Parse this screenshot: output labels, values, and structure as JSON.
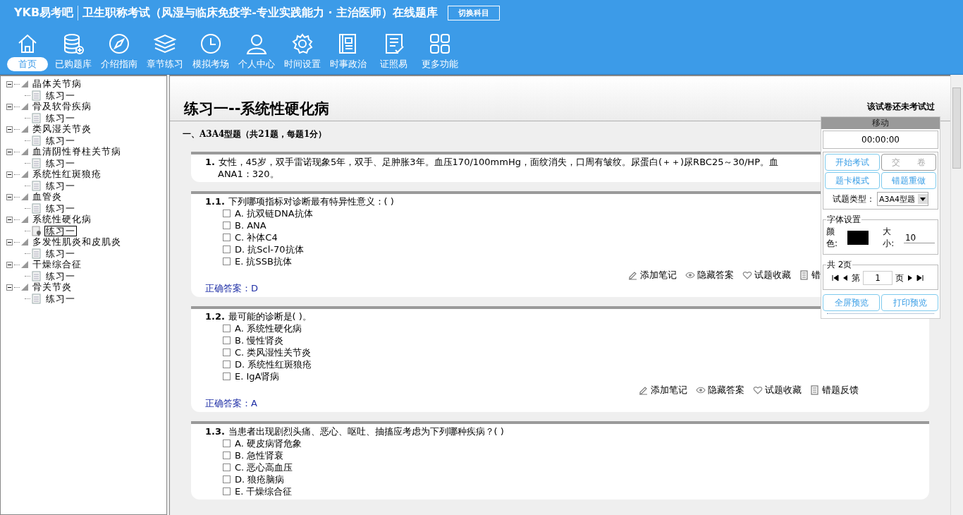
{
  "app": {
    "logo": "YKB易考吧",
    "title": "卫生职称考试（风湿与临床免疫学-专业实践能力 · 主治医师）在线题库",
    "switch_button": "切换科目"
  },
  "toolbar": [
    {
      "label": "首页",
      "selected": true
    },
    {
      "label": "已购题库",
      "selected": false
    },
    {
      "label": "介绍指南",
      "selected": false
    },
    {
      "label": "章节练习",
      "selected": false
    },
    {
      "label": "模拟考场",
      "selected": false
    },
    {
      "label": "个人中心",
      "selected": false
    },
    {
      "label": "时间设置",
      "selected": false
    },
    {
      "label": "时事政治",
      "selected": false
    },
    {
      "label": "证照易",
      "selected": false
    },
    {
      "label": "更多功能",
      "selected": false
    }
  ],
  "tree": [
    {
      "label": "晶体关节病",
      "expanded": true,
      "children": [
        {
          "label": "练习一",
          "selected": false
        }
      ]
    },
    {
      "label": "骨及软骨疾病",
      "expanded": true,
      "children": [
        {
          "label": "练习一",
          "selected": false
        }
      ]
    },
    {
      "label": "类风湿关节炎",
      "expanded": true,
      "children": [
        {
          "label": "练习一",
          "selected": false
        }
      ]
    },
    {
      "label": "血清阴性脊柱关节病",
      "expanded": true,
      "children": [
        {
          "label": "练习一",
          "selected": false
        }
      ]
    },
    {
      "label": "系统性红斑狼疮",
      "expanded": true,
      "children": [
        {
          "label": "练习一",
          "selected": false
        }
      ]
    },
    {
      "label": "血管炎",
      "expanded": true,
      "children": [
        {
          "label": "练习一",
          "selected": false
        }
      ]
    },
    {
      "label": "系统性硬化病",
      "expanded": true,
      "children": [
        {
          "label": "练习一",
          "selected": true
        }
      ]
    },
    {
      "label": "多发性肌炎和皮肌炎",
      "expanded": true,
      "children": [
        {
          "label": "练习一",
          "selected": false
        }
      ]
    },
    {
      "label": "干燥综合征",
      "expanded": true,
      "children": [
        {
          "label": "练习一",
          "selected": false
        }
      ]
    },
    {
      "label": "骨关节炎",
      "expanded": true,
      "children": [
        {
          "label": "练习一",
          "selected": false
        }
      ]
    }
  ],
  "paper": {
    "title": "练习一--系统性硬化病",
    "status": "该试卷还未考试过",
    "section": "一、A3A4型题（共21题，每题1分）"
  },
  "questions": [
    {
      "kind": "stem",
      "number": "1.",
      "text": "女性，45岁，双手雷诺现象5年，双手、足肿胀3年。血压170/100mmHg，面纹消失，口周有皱纹。尿蛋白(＋＋)尿RBC25～30/HP。血",
      "text2": "ANA1：320。"
    },
    {
      "kind": "choice",
      "number": "1.1.",
      "text": "下列哪项指标对诊断最有特异性意义：( )",
      "options": [
        {
          "letter": "A.",
          "text": "抗双链DNA抗体",
          "checked": false
        },
        {
          "letter": "B.",
          "text": "ANA",
          "checked": false
        },
        {
          "letter": "C.",
          "text": "补体C4",
          "checked": false
        },
        {
          "letter": "D.",
          "text": "抗Scl-70抗体",
          "checked": false
        },
        {
          "letter": "E.",
          "text": "抗SSB抗体",
          "checked": false
        }
      ],
      "actions": [
        {
          "label": "添加笔记"
        },
        {
          "label": "隐藏答案"
        },
        {
          "label": "试题收藏"
        },
        {
          "label": "错"
        }
      ],
      "answer_label": "正确答案：",
      "answer": "D"
    },
    {
      "kind": "choice",
      "number": "1.2.",
      "text": "最可能的诊断是( )。",
      "options": [
        {
          "letter": "A.",
          "text": "系统性硬化病",
          "checked": false
        },
        {
          "letter": "B.",
          "text": "慢性肾炎",
          "checked": false
        },
        {
          "letter": "C.",
          "text": "类风湿性关节炎",
          "checked": false
        },
        {
          "letter": "D.",
          "text": "系统性红斑狼疮",
          "checked": false
        },
        {
          "letter": "E.",
          "text": "IgA肾病",
          "checked": false
        }
      ],
      "actions": [
        {
          "label": "添加笔记"
        },
        {
          "label": "隐藏答案"
        },
        {
          "label": "试题收藏"
        },
        {
          "label": "错题反馈"
        }
      ],
      "answer_label": "正确答案：",
      "answer": "A"
    },
    {
      "kind": "choice",
      "number": "1.3.",
      "text": "当患者出现剧烈头痛、恶心、呕吐、抽搐应考虑为下列哪种疾病？( )",
      "options": [
        {
          "letter": "A.",
          "text": "硬皮病肾危象",
          "checked": false
        },
        {
          "letter": "B.",
          "text": "急性肾衰",
          "checked": false
        },
        {
          "letter": "C.",
          "text": "恶心高血压",
          "checked": false
        },
        {
          "letter": "D.",
          "text": "狼疮脑病",
          "checked": false
        },
        {
          "letter": "E.",
          "text": "干燥综合征",
          "checked": false
        }
      ]
    }
  ],
  "panel": {
    "header": "移动",
    "timer": "00:00:00",
    "buttons": [
      {
        "label": "开始考试",
        "disabled": false
      },
      {
        "label": "交　　卷",
        "disabled": true
      },
      {
        "label": "题卡模式",
        "disabled": false
      },
      {
        "label": "错题重做",
        "disabled": false
      }
    ],
    "type_label": "试题类型：",
    "type_value": "A3A4型题",
    "font_legend": "字体设置",
    "color_label": "颜色:",
    "color": "#000000",
    "size_label": "大小:",
    "size": "10",
    "pages_legend": "共 2页",
    "page_prefix": "第",
    "page": "1",
    "page_suffix": "页",
    "bottom_buttons": [
      "全屏预览",
      "打印预览"
    ]
  }
}
